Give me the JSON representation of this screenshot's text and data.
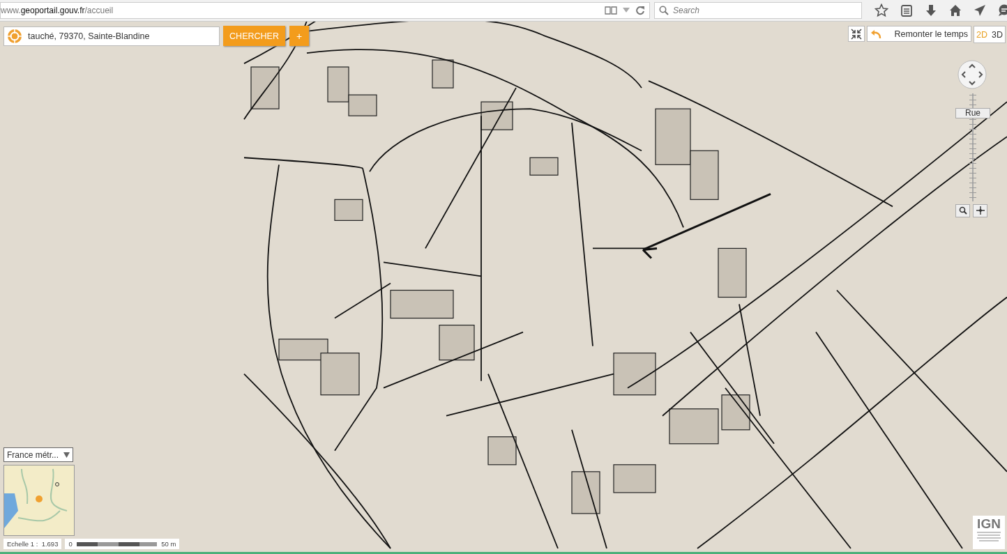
{
  "browser": {
    "url_host": "www.",
    "url_domain": "geoportail.gouv.fr",
    "url_path": "/accueil",
    "search": {
      "placeholder": "Search"
    }
  },
  "search": {
    "value": "tauché, 79370, Sainte-Blandine",
    "button": "CHERCHER",
    "more": "+"
  },
  "time_button": "Remonter le temps",
  "view_modes": [
    {
      "label": "2D",
      "selected": true
    },
    {
      "label": "3D",
      "selected": false
    }
  ],
  "zoom": {
    "label": "Rue",
    "level": 0.86
  },
  "territory": {
    "value": "France métr..."
  },
  "scale": {
    "text": "Echelle 1 :  1.693",
    "start": "0",
    "end": "50 m"
  },
  "logo": {
    "title": "IGN"
  }
}
